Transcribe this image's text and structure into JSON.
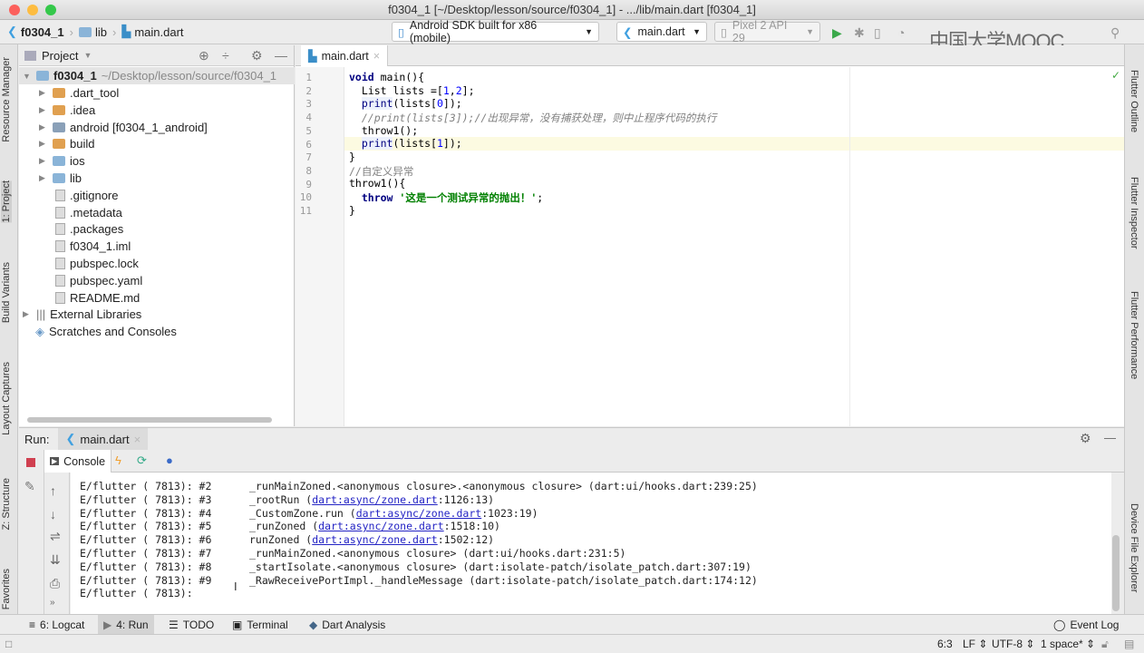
{
  "window": {
    "title": "f0304_1 [~/Desktop/lesson/source/f0304_1] - .../lib/main.dart [f0304_1]"
  },
  "navbar": {
    "breadcrumbs": [
      "f0304_1",
      "lib",
      "main.dart"
    ],
    "device": "Android SDK built for x86 (mobile)",
    "run_config": "main.dart",
    "avd": "Pixel 2 API 29",
    "watermark": "中国大学MOOC"
  },
  "left_strip": [
    "Resource Manager",
    "1: Project",
    "Build Variants",
    "Layout Captures",
    "Z: Structure",
    "Favorites"
  ],
  "right_strip": [
    "Flutter Outline",
    "Flutter Inspector",
    "Flutter Performance",
    "Device File Explorer"
  ],
  "project": {
    "view": "Project",
    "root": {
      "name": "f0304_1",
      "path": "~/Desktop/lesson/source/f0304_1"
    },
    "items": [
      {
        "label": ".dart_tool",
        "type": "folder",
        "color": "#e0a050"
      },
      {
        "label": ".idea",
        "type": "folder",
        "color": "#e0a050"
      },
      {
        "label": "android [f0304_1_android]",
        "type": "folder",
        "color": "#8aa0b8"
      },
      {
        "label": "build",
        "type": "folder",
        "color": "#e0a050"
      },
      {
        "label": "ios",
        "type": "folder",
        "color": "#8ab4d8"
      },
      {
        "label": "lib",
        "type": "folder",
        "color": "#8ab4d8"
      },
      {
        "label": ".gitignore",
        "type": "file"
      },
      {
        "label": ".metadata",
        "type": "file"
      },
      {
        "label": ".packages",
        "type": "file"
      },
      {
        "label": "f0304_1.iml",
        "type": "file"
      },
      {
        "label": "pubspec.lock",
        "type": "file"
      },
      {
        "label": "pubspec.yaml",
        "type": "file"
      },
      {
        "label": "README.md",
        "type": "file"
      }
    ],
    "external": "External Libraries",
    "scratches": "Scratches and Consoles"
  },
  "editor": {
    "tab": "main.dart",
    "current_line": 6,
    "lines": [
      "1",
      "2",
      "3",
      "4",
      "5",
      "6",
      "7",
      "8",
      "9",
      "10",
      "11"
    ]
  },
  "run": {
    "label": "Run:",
    "tab": "main.dart",
    "console_tab": "Console",
    "lines": [
      {
        "prefix": "E/flutter ( 7813): #2",
        "frame": "_runMainZoned.<anonymous closure>.<anonymous closure> (dart:ui/hooks.dart:239:25)"
      },
      {
        "prefix": "E/flutter ( 7813): #3",
        "pre": "_rootRun (",
        "link": "dart:async/zone.dart",
        "post": ":1126:13)"
      },
      {
        "prefix": "E/flutter ( 7813): #4",
        "pre": "_CustomZone.run (",
        "link": "dart:async/zone.dart",
        "post": ":1023:19)"
      },
      {
        "prefix": "E/flutter ( 7813): #5",
        "pre": "_runZoned (",
        "link": "dart:async/zone.dart",
        "post": ":1518:10)"
      },
      {
        "prefix": "E/flutter ( 7813): #6",
        "pre": "runZoned (",
        "link": "dart:async/zone.dart",
        "post": ":1502:12)"
      },
      {
        "prefix": "E/flutter ( 7813): #7",
        "frame": "_runMainZoned.<anonymous closure> (dart:ui/hooks.dart:231:5)"
      },
      {
        "prefix": "E/flutter ( 7813): #8",
        "frame": "_startIsolate.<anonymous closure> (dart:isolate-patch/isolate_patch.dart:307:19)"
      },
      {
        "prefix": "E/flutter ( 7813): #9",
        "frame": "_RawReceivePortImpl._handleMessage (dart:isolate-patch/isolate_patch.dart:174:12)"
      },
      {
        "prefix": "E/flutter ( 7813):",
        "frame": ""
      }
    ]
  },
  "bottom_tabs": [
    "6: Logcat",
    "4: Run",
    "TODO",
    "Terminal",
    "Dart Analysis"
  ],
  "event_log": "Event Log",
  "status": {
    "position": "6:3",
    "line_sep": "LF",
    "encoding": "UTF-8",
    "indent": "1 space*"
  }
}
